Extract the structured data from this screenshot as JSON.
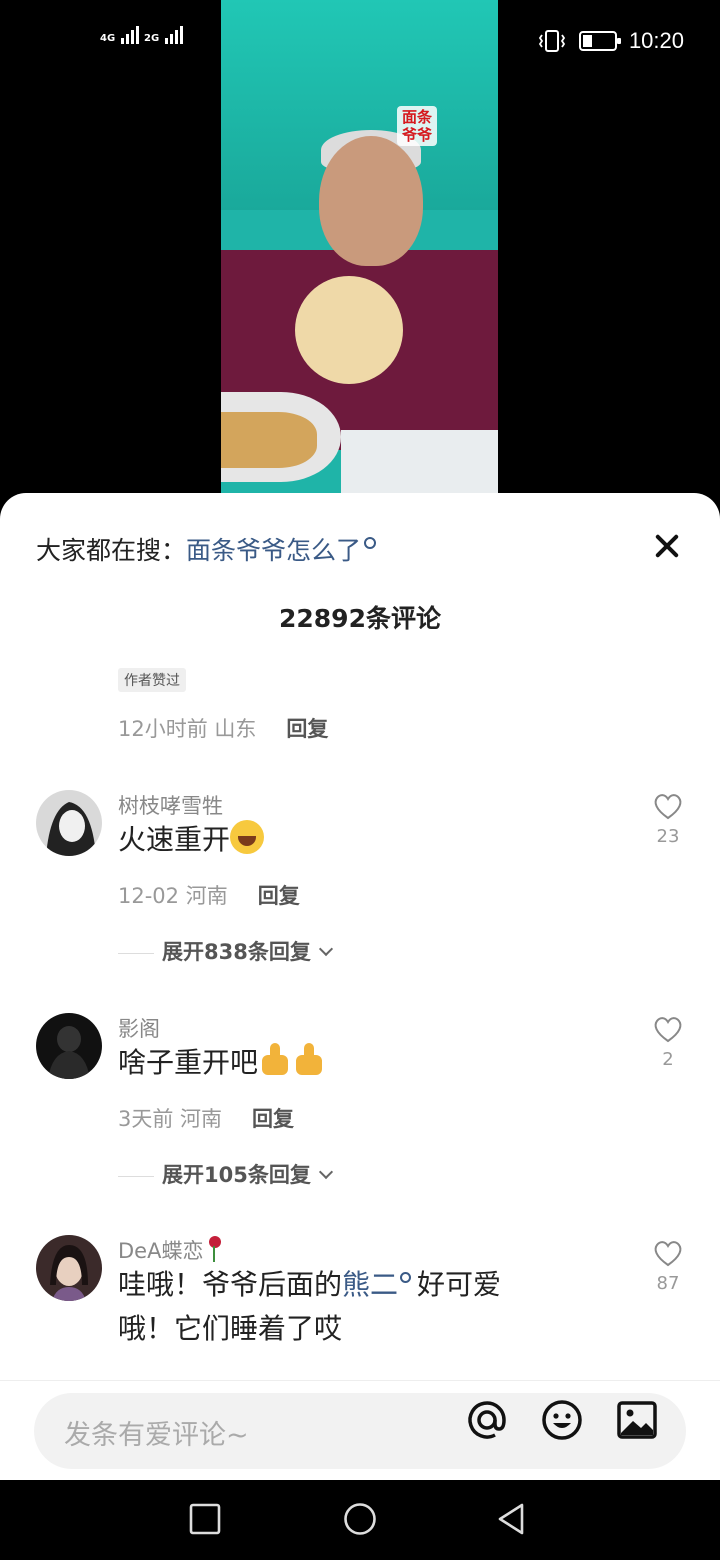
{
  "status_bar": {
    "signal1": "4G",
    "signal2": "2G",
    "time": "10:20",
    "battery_level": 0.3
  },
  "video": {
    "overlay_label": "面条爷爷"
  },
  "sheet": {
    "search": {
      "prefix": "大家都在搜：",
      "query": "面条爷爷怎么了"
    },
    "comment_count": "22892条评论",
    "partial_comment": {
      "author_tag": "作者赞过",
      "meta": "12小时前 山东",
      "reply": "回复"
    },
    "comments": [
      {
        "username": "树枝哮雪牲",
        "text": "火速重开",
        "emoji": "laughing-tears-emoji",
        "meta": "12-02 河南",
        "reply": "回复",
        "likes": "23",
        "expand": "展开838条回复"
      },
      {
        "username": "影阁",
        "text": "啥子重开吧",
        "emoji": "thumbs-up-emoji",
        "meta": "3天前 河南",
        "reply": "回复",
        "likes": "2",
        "expand": "展开105条回复"
      },
      {
        "username": "DeA蝶恋",
        "text_line1_part1": "哇哦！爷爷后面的",
        "text_line1_highlight": "熊二",
        "text_line1_part2": "好可爱",
        "text_line2": "哦！它们睡着了哎",
        "likes": "87"
      }
    ]
  },
  "input_bar": {
    "placeholder": "发条有爱评论~",
    "icons": [
      "at-icon",
      "emoji-icon",
      "image-icon"
    ]
  },
  "nav_bar": {
    "icons": [
      "recent-apps-icon",
      "home-icon",
      "back-icon"
    ]
  },
  "colors": {
    "link": "#3a5a86",
    "text": "#222222",
    "muted": "#999999"
  }
}
